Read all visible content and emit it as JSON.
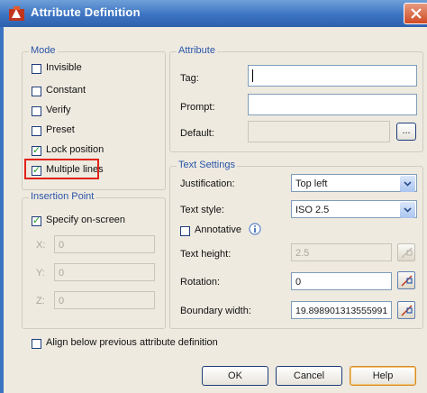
{
  "dialog": {
    "title": "Attribute Definition",
    "accent_color": "#3c74c3",
    "highlight_color": "#e2231a"
  },
  "mode": {
    "title": "Mode",
    "items": [
      {
        "label": "Invisible",
        "checked": false
      },
      {
        "label": "Constant",
        "checked": false
      },
      {
        "label": "Verify",
        "checked": false
      },
      {
        "label": "Preset",
        "checked": false
      },
      {
        "label": "Lock position",
        "checked": true
      },
      {
        "label": "Multiple lines",
        "checked": true
      }
    ]
  },
  "insertion": {
    "title": "Insertion Point",
    "specify_label": "Specify on-screen",
    "specify_checked": true,
    "x_label": "X:",
    "x_value": "0",
    "y_label": "Y:",
    "y_value": "0",
    "z_label": "Z:",
    "z_value": "0"
  },
  "attribute": {
    "title": "Attribute",
    "tag_label": "Tag:",
    "tag_value": "",
    "prompt_label": "Prompt:",
    "prompt_value": "",
    "default_label": "Default:",
    "default_value": "",
    "default_button": "..."
  },
  "text_settings": {
    "title": "Text Settings",
    "justification_label": "Justification:",
    "justification_value": "Top left",
    "style_label": "Text style:",
    "style_value": "ISO 2.5",
    "annotative_label": "Annotative",
    "annotative_checked": false,
    "info_icon": "info-icon",
    "height_label": "Text height:",
    "height_value": "2.5",
    "rotation_label": "Rotation:",
    "rotation_value": "0",
    "boundary_label": "Boundary width:",
    "boundary_value": "19.898901313555991"
  },
  "align_below": {
    "label": "Align below previous attribute definition",
    "checked": false
  },
  "buttons": {
    "ok": "OK",
    "cancel": "Cancel",
    "help": "Help"
  }
}
